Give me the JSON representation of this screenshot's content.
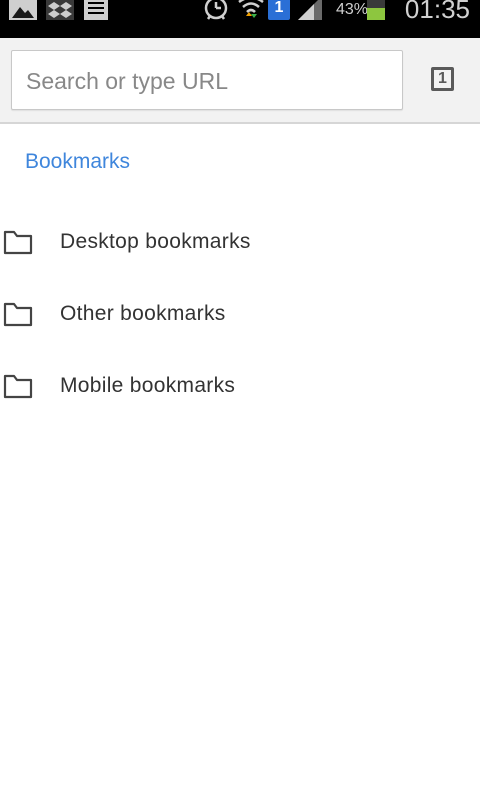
{
  "status_bar": {
    "battery_percent": "43%",
    "time": "01:35",
    "sim_badge": "1",
    "icons": [
      "gallery-icon",
      "dropbox-icon",
      "notes-icon",
      "alarm-icon",
      "wifi-icon",
      "sim-icon",
      "signal-icon",
      "battery-icon"
    ]
  },
  "toolbar": {
    "search_placeholder": "Search or type URL",
    "search_value": "",
    "tab_count": "1"
  },
  "bookmarks": {
    "title": "Bookmarks",
    "items": [
      {
        "label": "Desktop bookmarks",
        "icon": "folder-icon"
      },
      {
        "label": "Other bookmarks",
        "icon": "folder-icon"
      },
      {
        "label": "Mobile bookmarks",
        "icon": "folder-icon"
      }
    ]
  },
  "colors": {
    "accent": "#3f86dc",
    "status_bar": "#000000",
    "toolbar": "#f2f2f2",
    "battery_level": "#8dc63f"
  }
}
